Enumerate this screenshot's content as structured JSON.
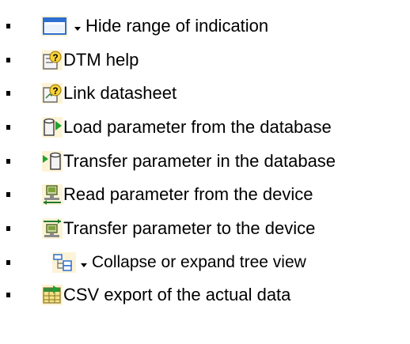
{
  "items": [
    {
      "label": "Hide range of indication",
      "icon": "window-range-icon",
      "has_dropdown": true
    },
    {
      "label": "DTM help",
      "icon": "help-document-icon",
      "has_dropdown": false
    },
    {
      "label": "Link datasheet",
      "icon": "link-datasheet-icon",
      "has_dropdown": false
    },
    {
      "label": "Load parameter from the database",
      "icon": "database-load-icon",
      "has_dropdown": false
    },
    {
      "label": "Transfer parameter in the database",
      "icon": "database-transfer-icon",
      "has_dropdown": false
    },
    {
      "label": "Read parameter from the device",
      "icon": "device-read-icon",
      "has_dropdown": false
    },
    {
      "label": "Transfer parameter to the device",
      "icon": "device-transfer-icon",
      "has_dropdown": false
    },
    {
      "label": "Collapse or expand tree view",
      "icon": "tree-view-icon",
      "has_dropdown": true
    },
    {
      "label": "CSV export of the actual data",
      "icon": "csv-export-icon",
      "has_dropdown": false
    }
  ]
}
